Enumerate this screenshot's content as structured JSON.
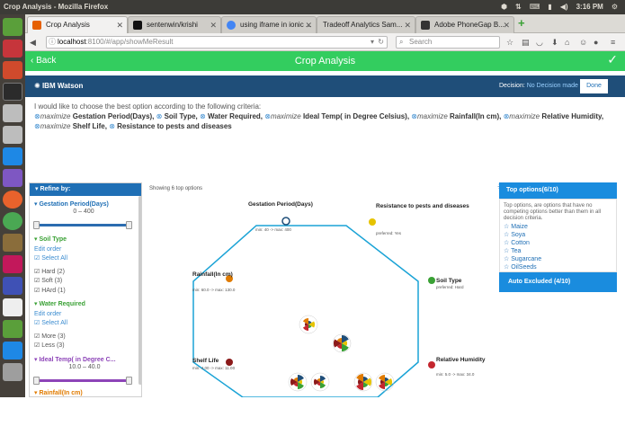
{
  "window_title": "Crop Analysis - Mozilla Firefox",
  "tray": {
    "time": "3:16 PM"
  },
  "tabs": [
    {
      "label": "Crop Analysis",
      "color": "#e66000",
      "active": true
    },
    {
      "label": "sentenwin/krishi",
      "color": "#111111",
      "active": false
    },
    {
      "label": "using iframe in ionic ...",
      "color": "#4285f4",
      "active": false
    },
    {
      "label": "Tradeoff Analytics Sam...",
      "color": "#ffffff",
      "active": false
    },
    {
      "label": "Adobe PhoneGap B...",
      "color": "#333333",
      "active": false
    }
  ],
  "url": {
    "host": "localhost",
    "path": ":8100/#/app/showMeResult"
  },
  "search_placeholder": "Search",
  "app_header": {
    "back": "Back",
    "title": "Crop Analysis"
  },
  "watson": {
    "logo": "IBM Watson",
    "decision_label": "Decision:",
    "decision_value": "No Decision made",
    "done": "Done"
  },
  "criteria": {
    "intro": "I would like to choose the best option according to the following criteria:",
    "items": [
      {
        "verb": "maximize",
        "name": "Gestation Period(Days),"
      },
      {
        "verb": "",
        "name": "Soil Type,"
      },
      {
        "verb": "",
        "name": "Water Required,"
      },
      {
        "verb": "maximize",
        "name": "Ideal Temp( in Degree Celsius),"
      },
      {
        "verb": "maximize",
        "name": "Rainfall(In cm),"
      },
      {
        "verb": "maximize",
        "name": "Relative Humidity,"
      },
      {
        "verb": "maximize",
        "name": "Shelf Life,"
      },
      {
        "verb": "",
        "name": "Resistance to pests and diseases"
      }
    ]
  },
  "refine": {
    "header": "Refine by:",
    "gestation": {
      "title": "Gestation Period(Days)",
      "range": "0 – 400"
    },
    "soil": {
      "title": "Soil Type",
      "edit": "Edit order",
      "select_all": "Select All",
      "options": [
        "Hard (2)",
        "Soft (3)",
        "HArd (1)"
      ]
    },
    "water": {
      "title": "Water Required",
      "edit": "Edit order",
      "select_all": "Select All",
      "options": [
        "More (3)",
        "Less (3)"
      ]
    },
    "temp": {
      "title": "Ideal Temp( in Degree C...",
      "range": "10.0 – 40.0"
    },
    "rainfall": {
      "title": "Rainfall(In cm)"
    }
  },
  "showing": "Showing 6 top options",
  "axes": [
    {
      "name": "Gestation Period(Days)",
      "info": "min: 40 -> max: 400",
      "color": "#1f4e79"
    },
    {
      "name": "Resistance to pests and diseases",
      "info": "preferred: Yes",
      "color": "#e6c300"
    },
    {
      "name": "Soil Type",
      "info": "preferred: Hard",
      "color": "#3aa135"
    },
    {
      "name": "Relative Humidity",
      "info": "min: 5.0 -> max: 34.0",
      "color": "#c4262e"
    },
    {
      "name": "Shelf Life",
      "info": "min: 4.00 -> max: 11.00",
      "color": "#8b1a1a"
    },
    {
      "name": "Rainfall(In cm)",
      "info": "min: 60.0 -> max: 130.0",
      "color": "#e07b00"
    }
  ],
  "top_options": {
    "header": "Top options(6/10)",
    "desc": "Top options, are options that have no competing options better than them in all decision criteria.",
    "items": [
      "Maize",
      "Soya",
      "Cotton",
      "Tea",
      "Sugarcane",
      "OilSeeds"
    ]
  },
  "auto_excluded": "Auto Excluded (4/10)"
}
